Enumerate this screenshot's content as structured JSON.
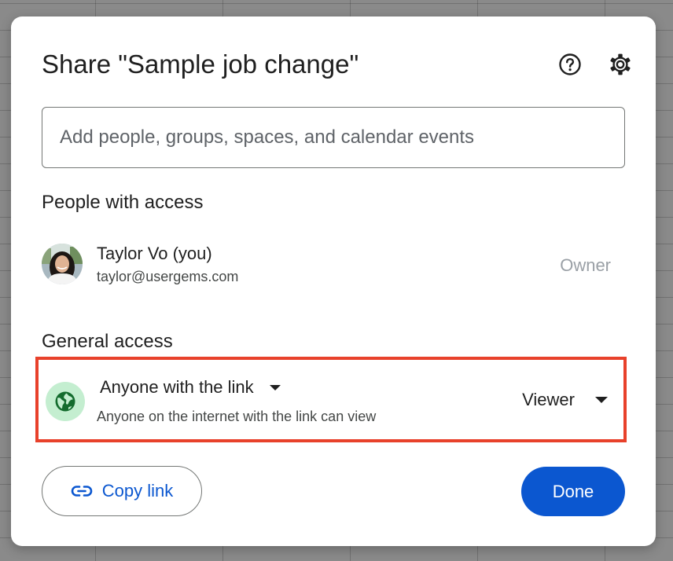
{
  "dialog": {
    "title": "Share \"Sample job change\"",
    "help_icon": "help-circle-icon",
    "settings_icon": "gear-icon"
  },
  "add_people": {
    "placeholder": "Add people, groups, spaces, and calendar events"
  },
  "people_with_access": {
    "heading": "People with access",
    "people": [
      {
        "name": "Taylor Vo (you)",
        "email": "taylor@usergems.com",
        "role": "Owner"
      }
    ]
  },
  "general_access": {
    "heading": "General access",
    "scope": "Anyone with the link",
    "description": "Anyone on the internet with the link can view",
    "role": "Viewer",
    "highlight_color": "#e8412b",
    "icon": "globe-icon"
  },
  "actions": {
    "copy_link": "Copy link",
    "done": "Done"
  },
  "colors": {
    "accent": "#0b57d0",
    "globe_bg": "#c4eed0"
  }
}
